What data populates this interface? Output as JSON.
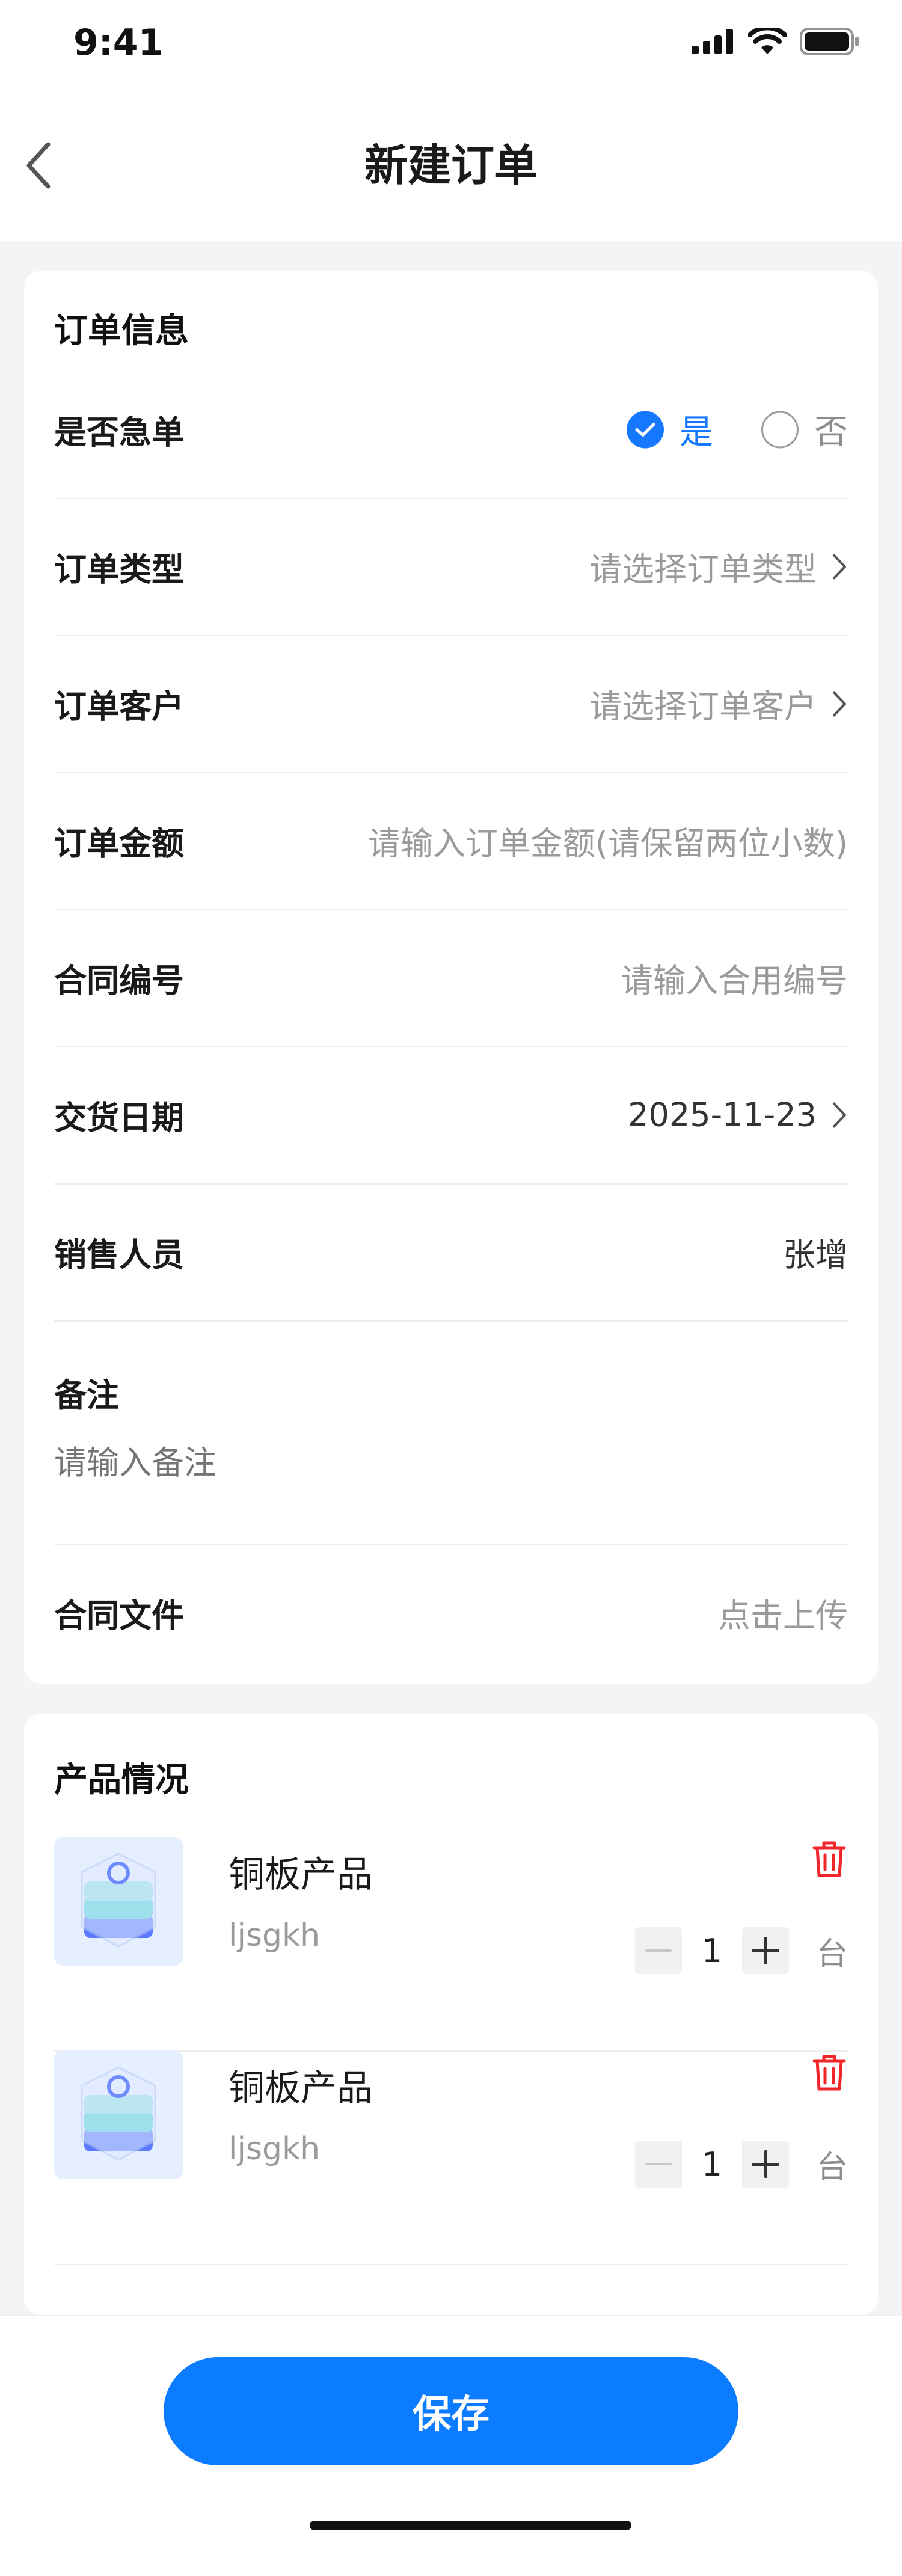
{
  "status": {
    "time": "9:41"
  },
  "nav": {
    "title": "新建订单"
  },
  "order_info": {
    "title": "订单信息",
    "urgent": {
      "label": "是否急单",
      "yes": "是",
      "no": "否",
      "selected": "是"
    },
    "type": {
      "label": "订单类型",
      "placeholder": "请选择订单类型"
    },
    "customer": {
      "label": "订单客户",
      "placeholder": "请选择订单客户"
    },
    "amount": {
      "label": "订单金额",
      "placeholder": "请输入订单金额(请保留两位小数)"
    },
    "contract_no": {
      "label": "合同编号",
      "placeholder": "请输入合用编号"
    },
    "delivery": {
      "label": "交货日期",
      "value": "2025-11-23"
    },
    "sales": {
      "label": "销售人员",
      "value": "张增"
    },
    "remark": {
      "label": "备注",
      "placeholder": "请输入备注"
    },
    "contract_file": {
      "label": "合同文件",
      "action": "点击上传"
    }
  },
  "products": {
    "title": "产品情况",
    "items": [
      {
        "name": "铜板产品",
        "spec": "ljsgkh",
        "qty": "1",
        "unit": "台"
      },
      {
        "name": "铜板产品",
        "spec": "ljsgkh",
        "qty": "1",
        "unit": "台"
      }
    ]
  },
  "footer": {
    "save_label": "保存"
  },
  "colors": {
    "accent": "#1677ff",
    "danger": "#f0262b",
    "save": "#0b7cff"
  }
}
